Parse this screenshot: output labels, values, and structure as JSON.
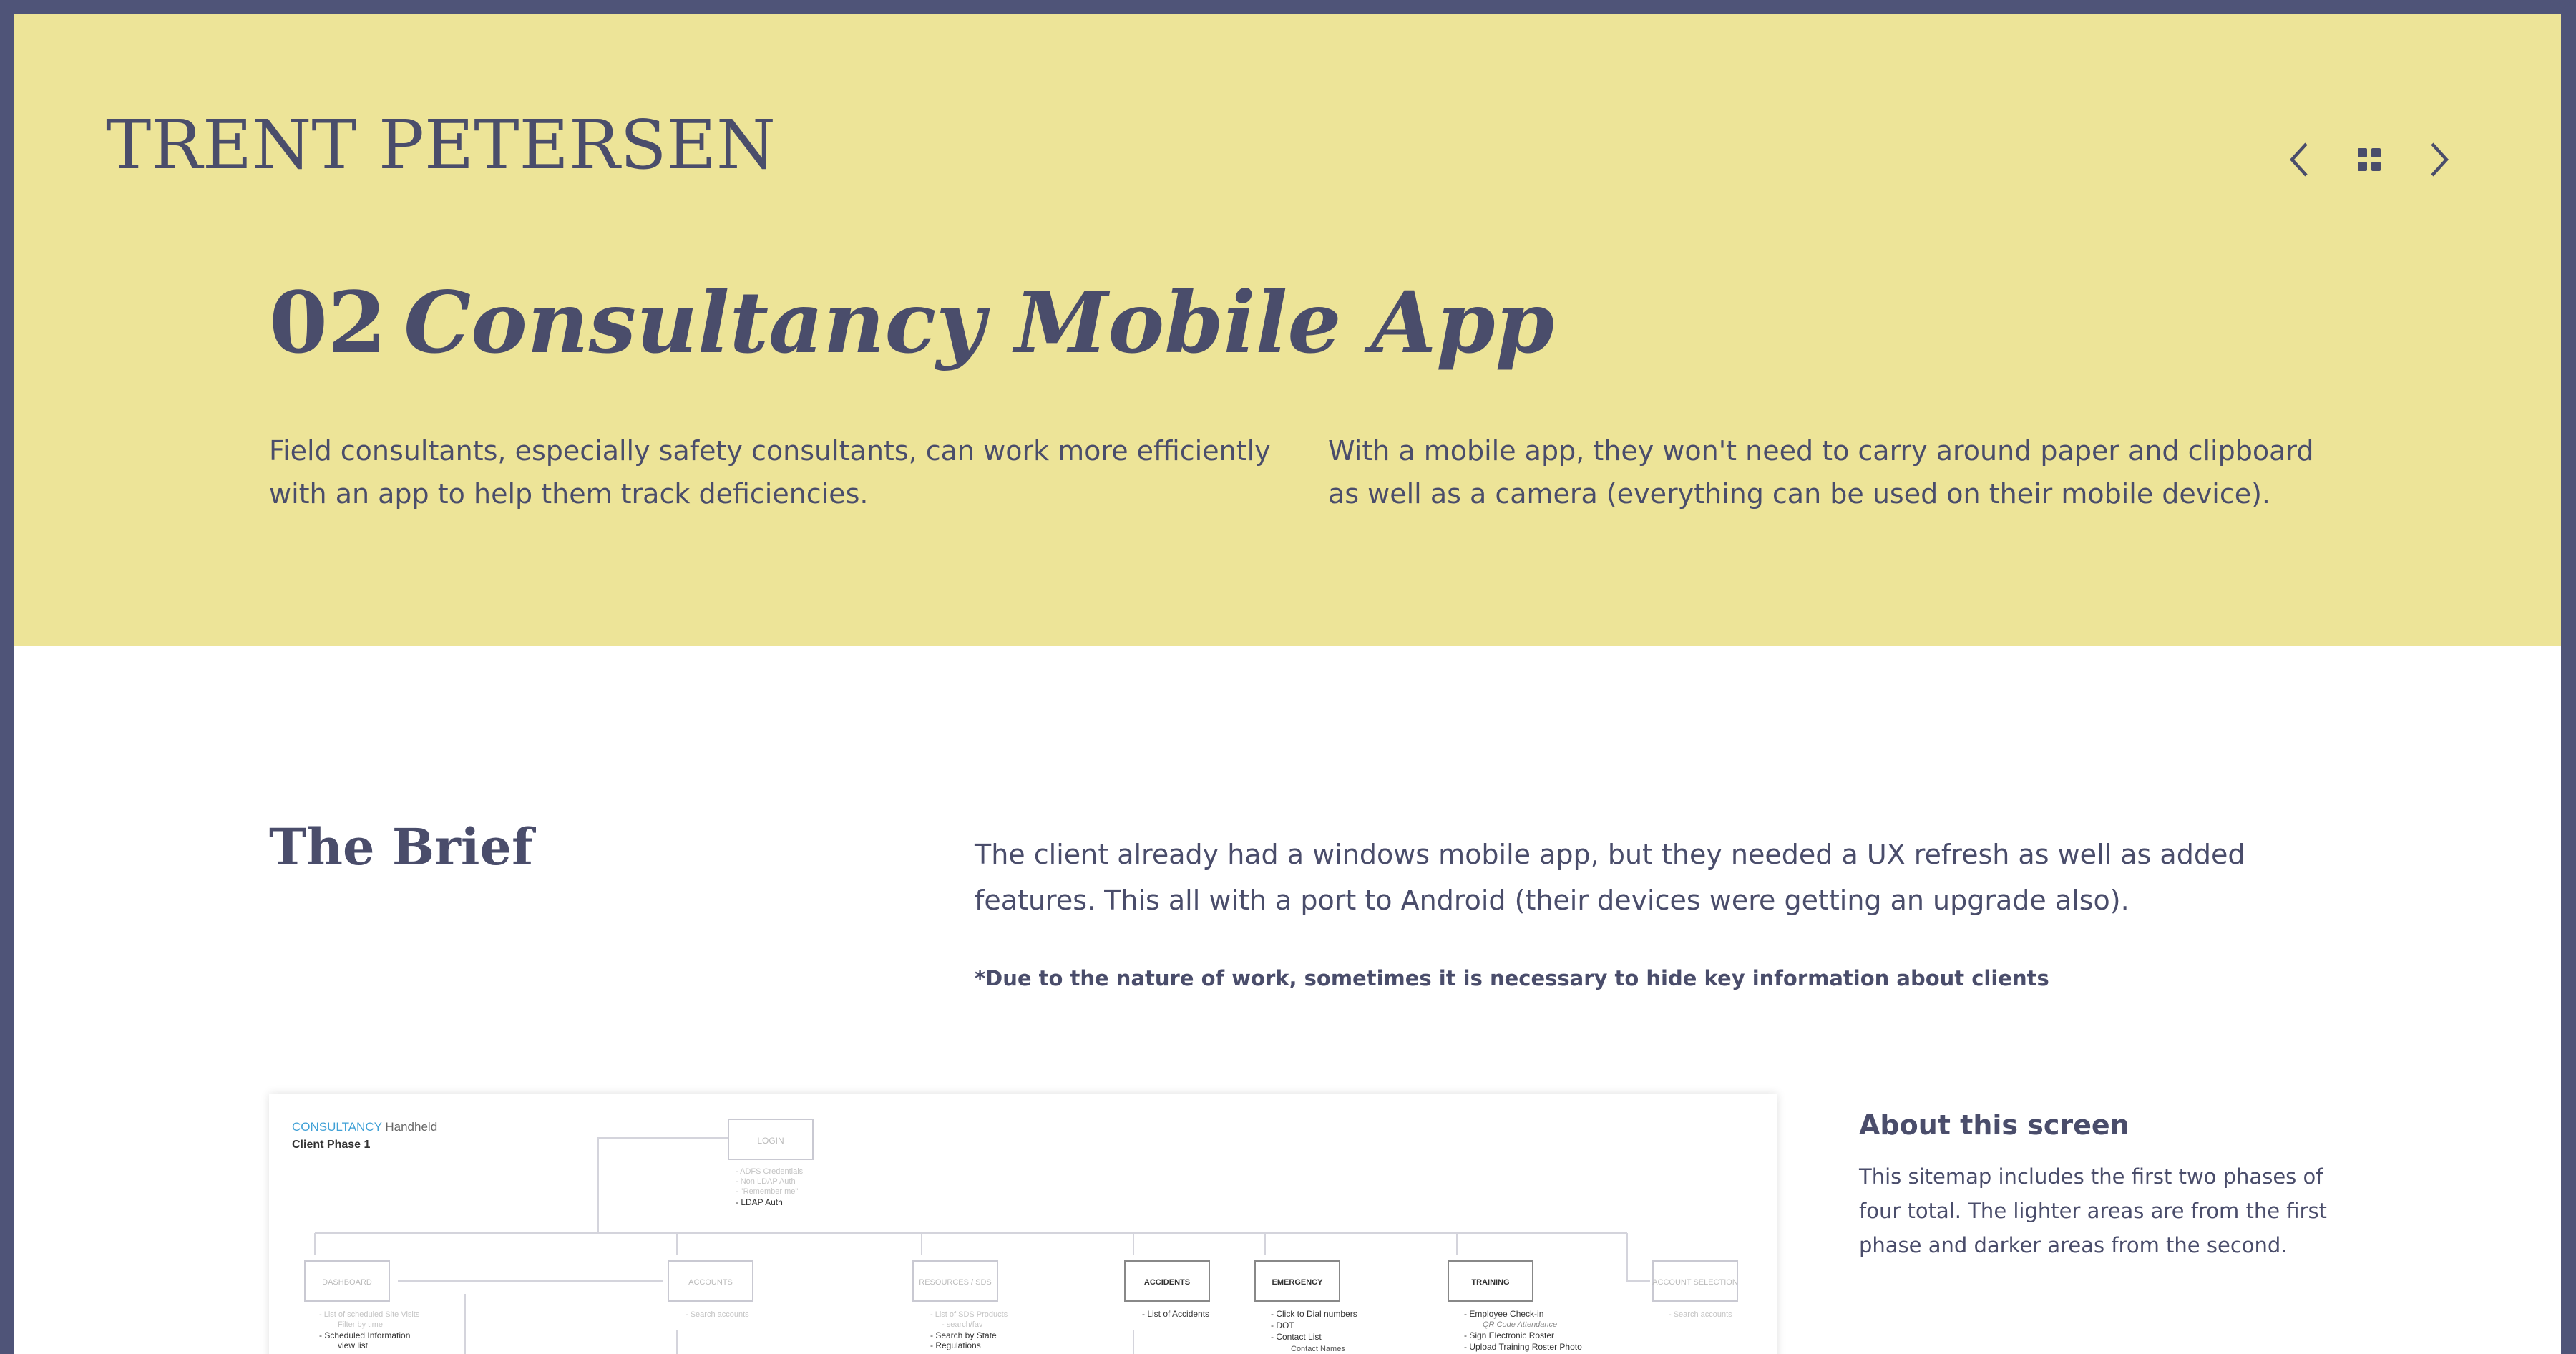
{
  "header": {
    "brand": "TRENT PETERSEN",
    "nav": {
      "prev_icon": "chevron-left-icon",
      "grid_icon": "grid-icon",
      "next_icon": "chevron-right-icon"
    }
  },
  "project": {
    "number": "02",
    "name": "Consultancy Mobile App",
    "intro_left": "Field consultants, especially safety consultants, can work more efficiently with an app to help them track deficiencies.",
    "intro_right": "With a mobile app, they won't need to carry around paper and clipboard as well as a camera (everything can be used on their mobile device)."
  },
  "brief": {
    "heading": "The Brief",
    "body": "The client already had a windows mobile app, but they needed a UX refresh as well as added features. This all with a port to Android (their devices were getting an upgrade also).",
    "note": "*Due to the nature of work, sometimes it is necessary to hide key information about clients"
  },
  "sitemap": {
    "brand_word": "CONSULTANCY",
    "brand_sub": "Handheld",
    "phase": "Client Phase 1",
    "login": {
      "label": "LOGIN",
      "items_light": [
        "- ADFS Credentials",
        "- Non LDAP Auth",
        "- \"Remember me\""
      ],
      "items_dark": [
        "- LDAP Auth"
      ]
    },
    "sections": [
      {
        "label": "DASHBOARD",
        "light": true,
        "items_light": [
          "- List of scheduled Site Visits",
          "Filter by time"
        ],
        "items_dark": [
          "- Scheduled Information",
          "view list"
        ]
      },
      {
        "label": "ACCOUNTS",
        "light": true,
        "items_light": [
          "- Search accounts"
        ],
        "items_dark": []
      },
      {
        "label": "RESOURCES / SDS",
        "light": true,
        "items_light": [
          "- List of SDS Products",
          "- search/fav"
        ],
        "items_dark": [
          "- Search by State",
          "- Regulations"
        ]
      },
      {
        "label": "ACCIDENTS",
        "light": false,
        "items_light": [],
        "items_dark": [
          "- List of Accidents"
        ]
      },
      {
        "label": "EMERGENCY",
        "light": false,
        "items_light": [],
        "items_dark": [
          "- Click to Dial numbers",
          "- DOT",
          "- Contact List",
          "Contact Names"
        ]
      },
      {
        "label": "TRAINING",
        "light": false,
        "items_light": [
          "QR Code Attendance"
        ],
        "items_dark": [
          "- Employee Check-in",
          "- Sign Electronic Roster",
          "- Upload Training Roster Photo"
        ]
      },
      {
        "label": "ACCOUNT SELECTION",
        "light": true,
        "items_light": [
          "- Search accounts"
        ],
        "items_dark": []
      }
    ]
  },
  "about": {
    "title": "About this screen",
    "body": "This sitemap includes the first two phases of four total. The lighter areas are from the first phase and darker areas from the second."
  },
  "colors": {
    "page_border": "#4f5478",
    "hero_bg": "#ede498",
    "text": "#4a4d6b",
    "sitemap_accent": "#3fa0d6"
  }
}
